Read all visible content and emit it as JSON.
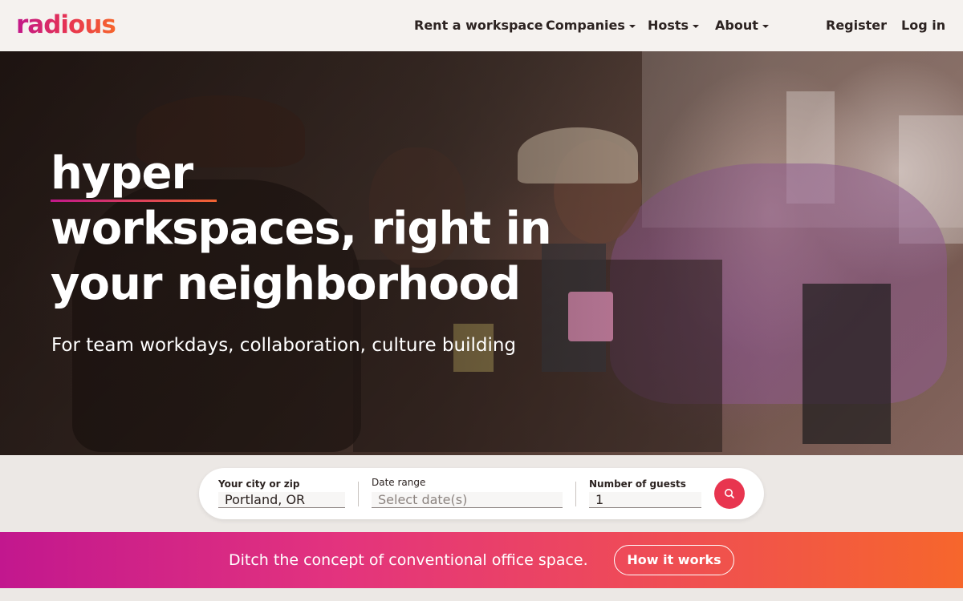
{
  "header": {
    "logo_text": "radious",
    "nav": {
      "rent": "Rent a workspace",
      "companies": "Companies",
      "hosts": "Hosts",
      "about": "About",
      "register": "Register",
      "login": "Log in"
    }
  },
  "hero": {
    "title_line1": "hyper",
    "title_line2": "workspaces, right in",
    "title_line3": "your neighborhood",
    "subtitle": "For team workdays, collaboration, culture building"
  },
  "search": {
    "city_label": "Your city or zip",
    "city_value": "Portland, OR",
    "date_label": "Date range",
    "date_placeholder": "Select date(s)",
    "guests_label": "Number of guests",
    "guests_value": "1",
    "search_icon": "search-icon"
  },
  "banner": {
    "text": "Ditch the concept of conventional office space.",
    "button_label": "How it works"
  },
  "colors": {
    "brand_pink": "#c2188a",
    "brand_red": "#e8354f",
    "brand_orange": "#f6662c",
    "text_dark": "#2c2321",
    "header_bg": "#f5f2ef"
  }
}
